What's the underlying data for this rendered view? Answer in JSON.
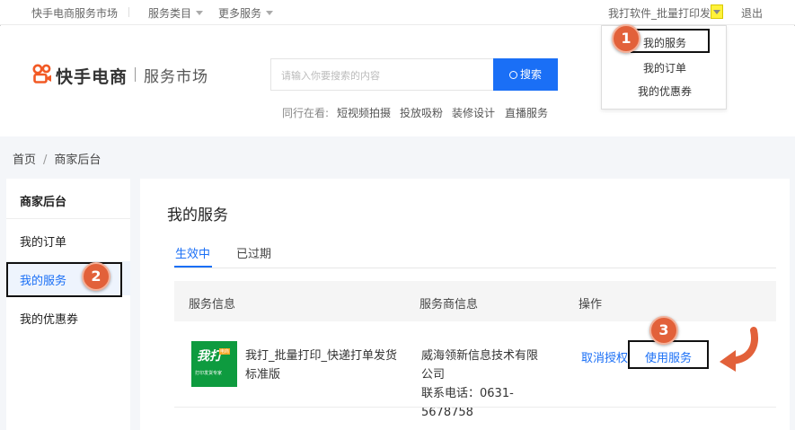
{
  "topbar": {
    "market": "快手电商服务市场",
    "categories": "服务类目",
    "more": "更多服务",
    "user": "我打软件_批量打印发货",
    "logout": "退出"
  },
  "dropdown": {
    "items": [
      "我的服务",
      "我的订单",
      "我的优惠券"
    ]
  },
  "header": {
    "logo_main": "快手电商",
    "logo_sub": "服务市场",
    "search_placeholder": "请输入你要搜索的内容",
    "search_button": "搜索",
    "hot_label": "同行在看:",
    "hot_links": [
      "短视频拍摄",
      "投放吸粉",
      "装修设计",
      "直播服务"
    ]
  },
  "breadcrumb": [
    "首页",
    "商家后台"
  ],
  "sidebar": {
    "title": "商家后台",
    "items": [
      "我的订单",
      "我的服务",
      "我的优惠券"
    ]
  },
  "main": {
    "title": "我的服务",
    "tabs": [
      "生效中",
      "已过期"
    ],
    "columns": [
      "服务信息",
      "服务商信息",
      "操作"
    ],
    "row": {
      "image_main": "我打",
      "image_tag": "电商",
      "image_sub": "打印发货专家",
      "service_name_line1": "我打_批量打印_快递打单发货",
      "service_name_line2": "标准版",
      "provider_line1": "威海领新信息技术有限",
      "provider_line2": "公司",
      "phone_line1": "联系电话：0631-",
      "phone_line2": "5678758",
      "cancel_auth": "取消授权",
      "use_service": "使用服务"
    }
  },
  "annotations": [
    "1",
    "2",
    "3"
  ],
  "colors": {
    "accent": "#1a6ff6",
    "badge": "#e2613a",
    "logo": "#f25a25"
  }
}
